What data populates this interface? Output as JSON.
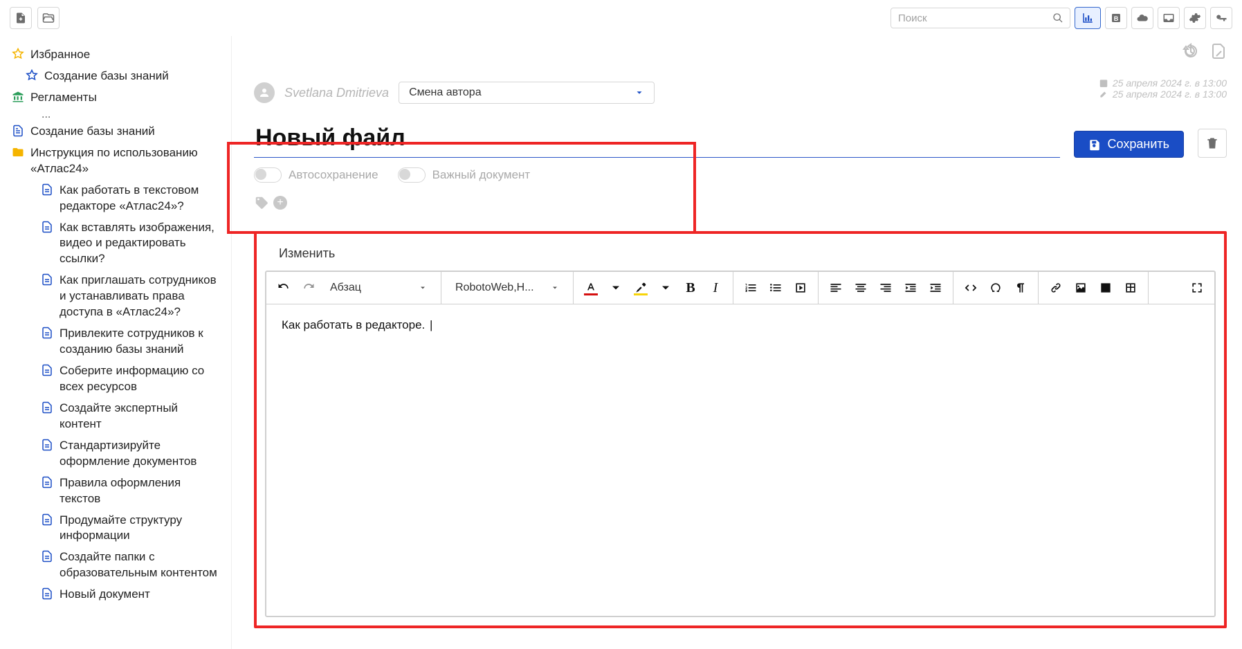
{
  "appbar": {
    "search_placeholder": "Поиск"
  },
  "sidebar": {
    "favorites_label": "Избранное",
    "fav_item_1": "Создание базы знаний",
    "reg_label": "Регламенты",
    "ellipsis": "...",
    "kb_root": "Создание базы знаний",
    "instr_root": "Инструкция по использованию «Атлас24»",
    "docs": {
      "d1": "Как работать в текстовом редакторе «Атлас24»?",
      "d2": "Как вставлять изображения, видео и редактировать ссылки?",
      "d3": "Как приглашать сотрудников и устанавливать права доступа в «Атлас24»?",
      "d4": "Привлеките сотрудников к созданию базы знаний",
      "d5": "Соберите информацию со всех ресурсов",
      "d6": "Создайте экспертный контент",
      "d7": "Стандартизируйте оформление документов",
      "d8": "Правила оформления текстов",
      "d9": "Продумайте структуру информации",
      "d10": "Создайте папки с образовательным контентом",
      "d11": "Новый документ"
    }
  },
  "main": {
    "author_name": "Svetlana Dmitrieva",
    "author_select_label": "Смена автора",
    "created_date": "25 апреля 2024 г. в 13:00",
    "modified_date": "25 апреля 2024 г. в 13:00",
    "title_value": "Новый файл",
    "save_label": "Сохранить",
    "toggle_autosave": "Автосохранение",
    "toggle_important": "Важный документ"
  },
  "editor": {
    "tab_label": "Изменить",
    "style_dropdown": "Абзац",
    "font_dropdown": "RobotoWeb,H...",
    "body_text": "Как работать в редакторе. "
  }
}
